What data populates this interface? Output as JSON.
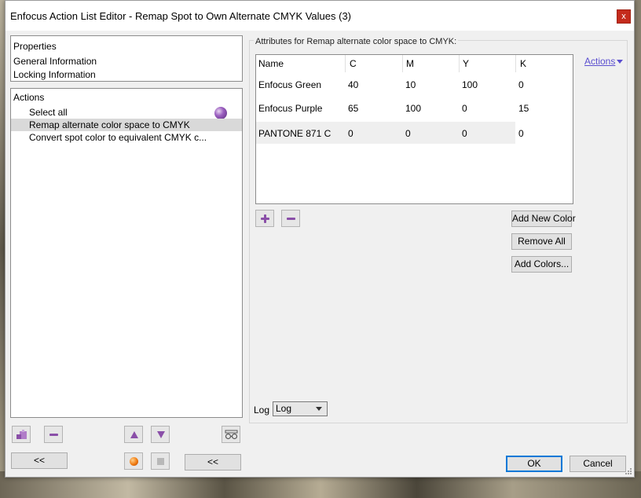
{
  "window": {
    "title": "Enfocus Action List Editor - Remap Spot to Own Alternate CMYK Values (3)",
    "close_glyph": "x"
  },
  "properties": {
    "header": "Properties",
    "items": [
      "General Information",
      "Locking Information"
    ]
  },
  "actions_panel": {
    "header": "Actions",
    "items": [
      {
        "label": "Select all",
        "selected": false
      },
      {
        "label": "Remap alternate color space to CMYK",
        "selected": true
      },
      {
        "label": "Convert spot color to equivalent CMYK c...",
        "selected": false
      }
    ]
  },
  "attributes": {
    "label": "Attributes for Remap alternate color space to CMYK:",
    "actions_link": "Actions",
    "columns": [
      "Name",
      "C",
      "M",
      "Y",
      "K"
    ],
    "rows": [
      [
        "Enfocus Green",
        "40",
        "10",
        "100",
        "0"
      ],
      [
        "Enfocus Purple",
        "65",
        "100",
        "0",
        "15"
      ],
      [
        "PANTONE 871 C",
        "0",
        "0",
        "0",
        "0"
      ]
    ],
    "add_new_color": "Add New Color",
    "remove_all": "Remove All",
    "add_colors": "Add Colors..."
  },
  "log": {
    "label": "Log",
    "value": "Log"
  },
  "bottom": {
    "collapse_left": "<<",
    "collapse_right": "<<",
    "ok": "OK",
    "cancel": "Cancel"
  },
  "colors": {
    "accent_purple": "#8a4fa8",
    "link_blue": "#5b4fd0",
    "default_border": "#0078d7",
    "close_red": "#c42b1c"
  }
}
